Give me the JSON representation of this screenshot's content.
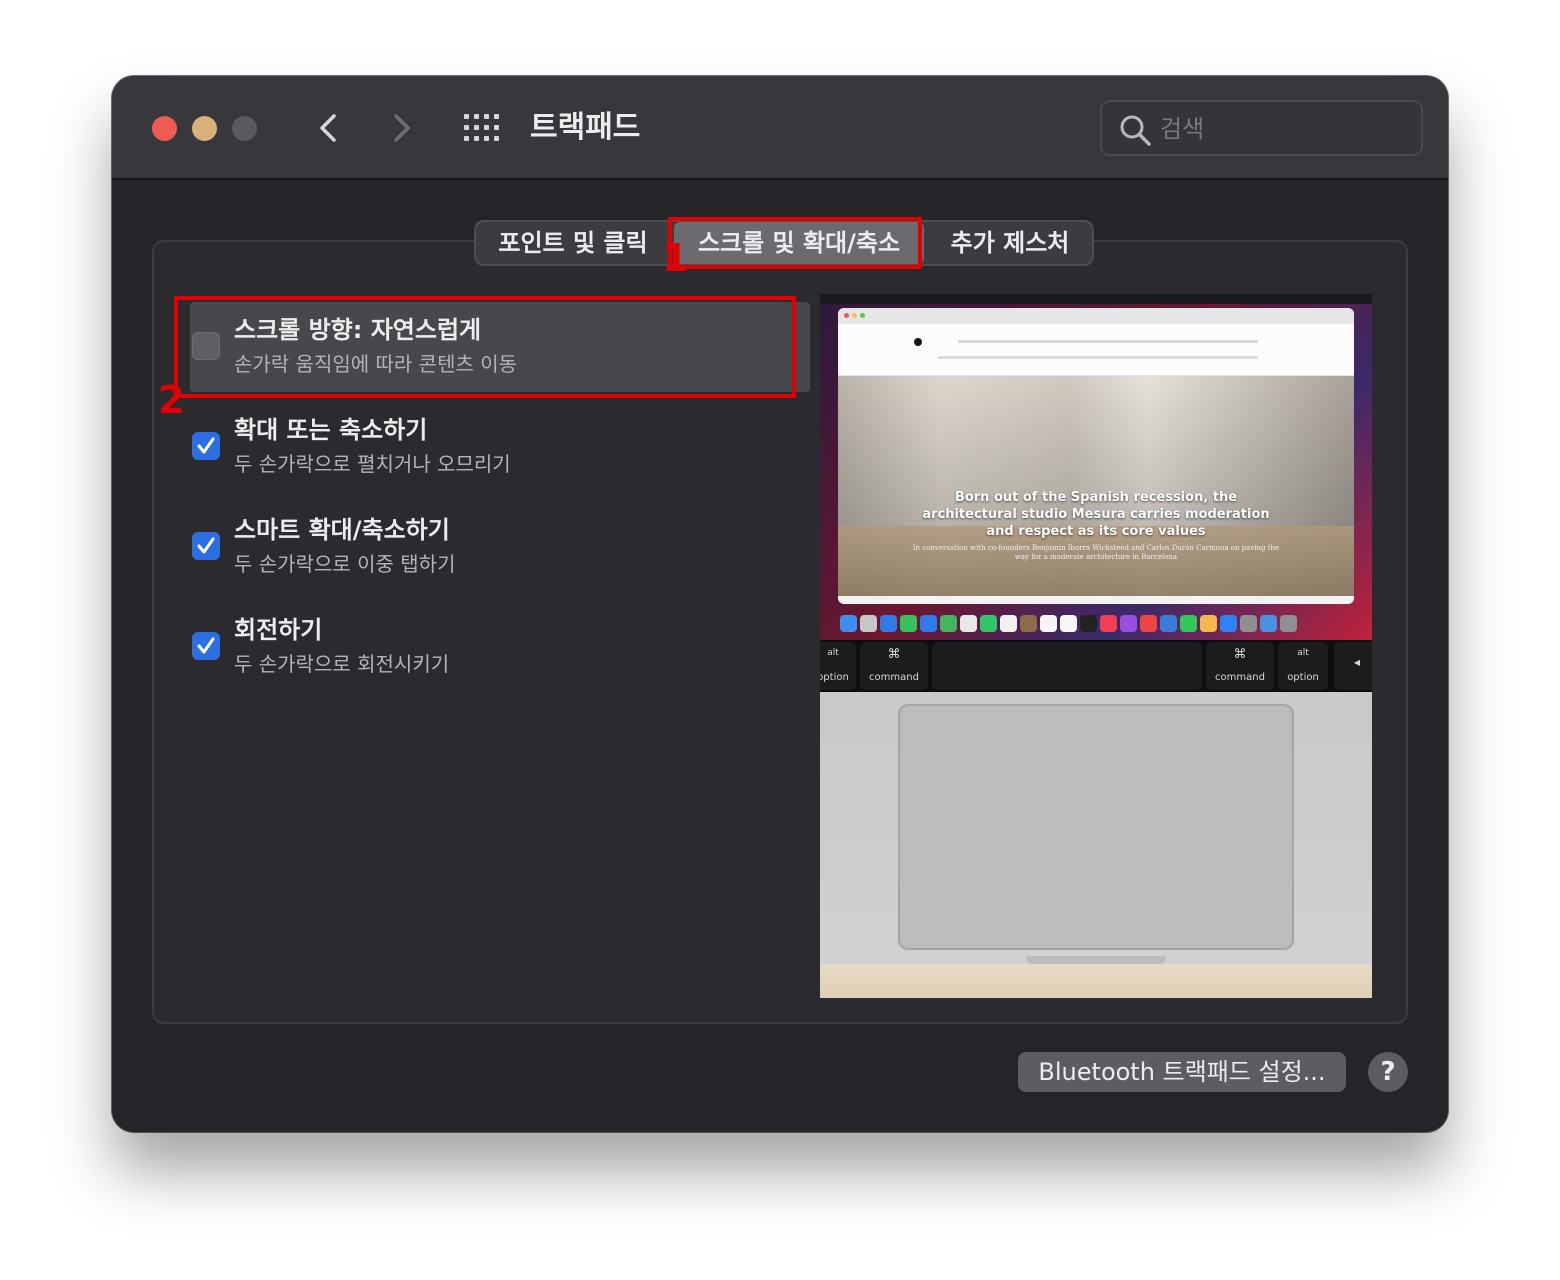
{
  "window": {
    "title": "트랙패드",
    "search": {
      "placeholder": "검색",
      "value": ""
    },
    "icons": {
      "back": "chevron-left-icon",
      "forward": "chevron-right-icon",
      "show_all": "grid-icon",
      "search": "search-icon"
    }
  },
  "tabs": [
    {
      "label": "포인트 및 클릭",
      "selected": false
    },
    {
      "label": "스크롤 및 확대/축소",
      "selected": true
    },
    {
      "label": "추가 제스처",
      "selected": false
    }
  ],
  "options": [
    {
      "title": "스크롤 방향: 자연스럽게",
      "description": "손가락 움직임에 따라 콘텐츠 이동",
      "checked": false
    },
    {
      "title": "확대 또는 축소하기",
      "description": "두 손가락으로 펼치거나 오므리기",
      "checked": true
    },
    {
      "title": "스마트 확대/축소하기",
      "description": "두 손가락으로 이중 탭하기",
      "checked": true
    },
    {
      "title": "회전하기",
      "description": "두 손가락으로 회전시키기",
      "checked": true
    }
  ],
  "preview": {
    "headline": [
      "Born out of the Spanish recession, the",
      "architectural studio Mesura carries moderation",
      "and respect as its core values"
    ],
    "subtext": "In conversation with co-founders Benjamin Iborra Wicksteed and Carlos Durán Carmona on paving the way for a moderate architecture in Barcelona",
    "keys": {
      "left_alt_top": "alt",
      "left_alt_bottom": "option",
      "left_cmd_top": "⌘",
      "left_cmd_bottom": "command",
      "right_cmd_top": "⌘",
      "right_cmd_bottom": "command",
      "right_alt_top": "alt",
      "right_alt_bottom": "option",
      "arrow": "◀"
    }
  },
  "annotations": {
    "marker_1": "1",
    "marker_2": "2",
    "color": "#e00000"
  },
  "footer": {
    "bluetooth_button": "Bluetooth 트랙패드 설정...",
    "help": "?"
  },
  "colors": {
    "accent": "#2d6fe3",
    "window_bg": "#252428"
  }
}
